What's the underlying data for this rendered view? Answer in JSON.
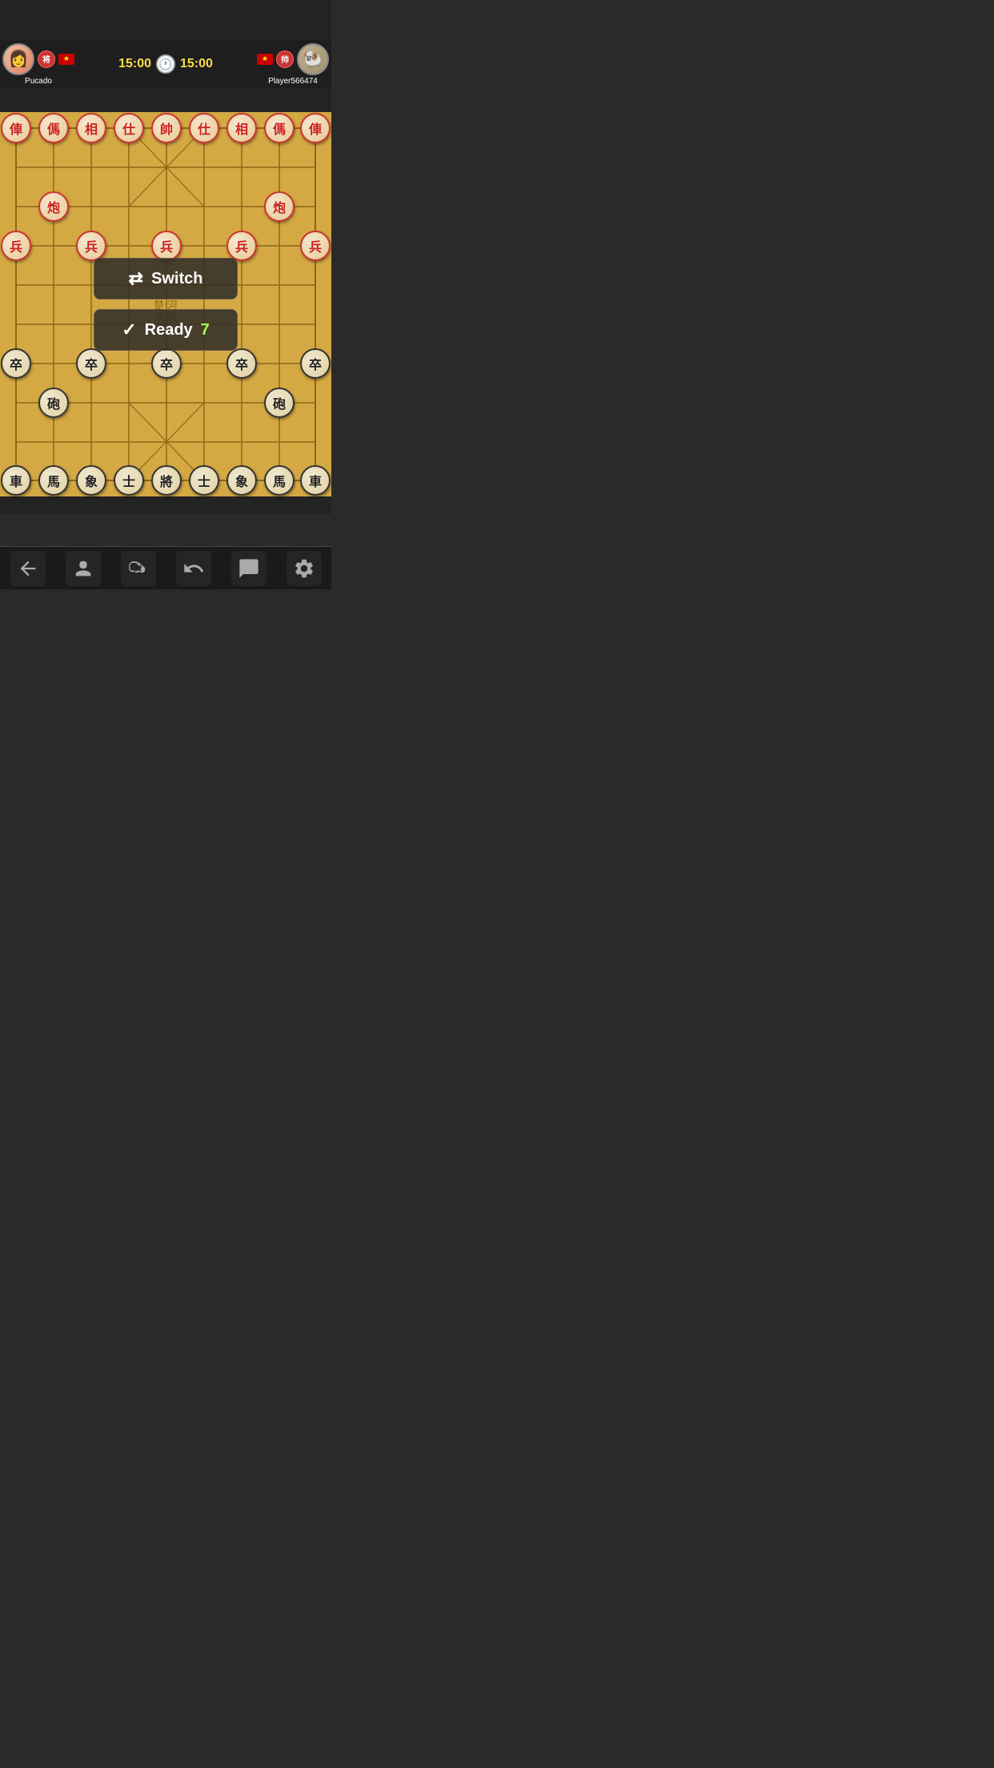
{
  "header": {
    "player1": {
      "name": "Pucado",
      "rank": "将",
      "flag": "🇻🇳",
      "avatar_type": "female"
    },
    "player2": {
      "name": "Player566474",
      "rank": "帅",
      "flag": "🇻🇳",
      "avatar_type": "animal"
    },
    "timer1": "15:00",
    "timer2": "15:00"
  },
  "board": {
    "red_pieces": [
      {
        "char": "俥",
        "col": 0,
        "row": 0
      },
      {
        "char": "傌",
        "col": 1,
        "row": 0
      },
      {
        "char": "相",
        "col": 2,
        "row": 0
      },
      {
        "char": "仕",
        "col": 3,
        "row": 0
      },
      {
        "char": "帥",
        "col": 4,
        "row": 0
      },
      {
        "char": "仕",
        "col": 5,
        "row": 0
      },
      {
        "char": "相",
        "col": 6,
        "row": 0
      },
      {
        "char": "傌",
        "col": 7,
        "row": 0
      },
      {
        "char": "俥",
        "col": 8,
        "row": 0
      },
      {
        "char": "炮",
        "col": 1,
        "row": 2
      },
      {
        "char": "炮",
        "col": 7,
        "row": 2
      },
      {
        "char": "兵",
        "col": 0,
        "row": 3
      },
      {
        "char": "兵",
        "col": 2,
        "row": 3
      },
      {
        "char": "兵",
        "col": 4,
        "row": 3
      },
      {
        "char": "兵",
        "col": 6,
        "row": 3
      },
      {
        "char": "兵",
        "col": 8,
        "row": 3
      }
    ],
    "black_pieces": [
      {
        "char": "卒",
        "col": 0,
        "row": 6
      },
      {
        "char": "卒",
        "col": 2,
        "row": 6
      },
      {
        "char": "卒",
        "col": 4,
        "row": 6
      },
      {
        "char": "卒",
        "col": 6,
        "row": 6
      },
      {
        "char": "卒",
        "col": 8,
        "row": 6
      },
      {
        "char": "砲",
        "col": 1,
        "row": 7
      },
      {
        "char": "砲",
        "col": 7,
        "row": 7
      },
      {
        "char": "車",
        "col": 0,
        "row": 9
      },
      {
        "char": "馬",
        "col": 1,
        "row": 9
      },
      {
        "char": "象",
        "col": 2,
        "row": 9
      },
      {
        "char": "士",
        "col": 3,
        "row": 9
      },
      {
        "char": "將",
        "col": 4,
        "row": 9
      },
      {
        "char": "士",
        "col": 5,
        "row": 9
      },
      {
        "char": "象",
        "col": 6,
        "row": 9
      },
      {
        "char": "馬",
        "col": 7,
        "row": 9
      },
      {
        "char": "車",
        "col": 8,
        "row": 9
      }
    ]
  },
  "popups": {
    "switch_label": "Switch",
    "ready_label": "Ready",
    "ready_count": "7"
  },
  "toolbar": {
    "back_label": "back",
    "person_label": "person",
    "handshake_label": "handshake",
    "undo_label": "undo",
    "chat_label": "chat",
    "settings_label": "settings"
  }
}
